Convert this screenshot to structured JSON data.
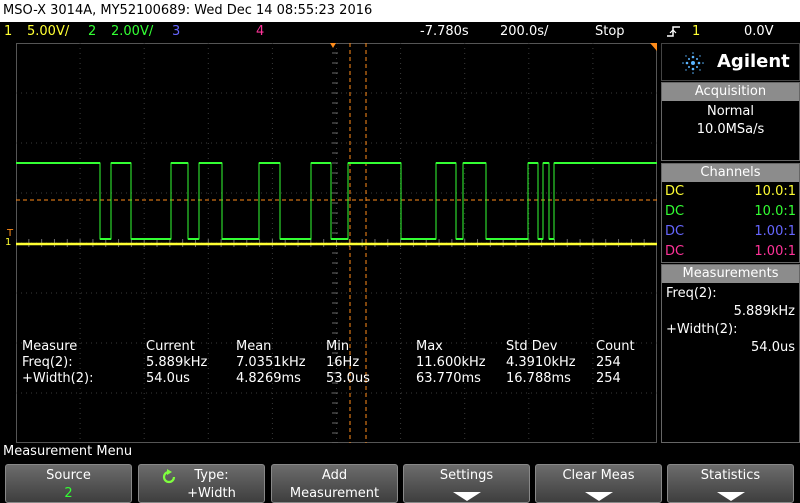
{
  "title": "MSO-X 3014A, MY52100689: Wed Dec 14 08:55:23 2016",
  "status": {
    "ch1_num": "1",
    "ch1_scale": "5.00V/",
    "ch2_num": "2",
    "ch2_scale": "2.00V/",
    "ch3_num": "3",
    "ch4_num": "4",
    "time_offset": "-7.780s",
    "time_scale": "200.0s/",
    "run_state": "Stop",
    "trig_icon": "rising-edge-trigger-icon",
    "trig_ch": "1",
    "trig_level": "0.0V"
  },
  "colors": {
    "ch1": "#ffff33",
    "ch2": "#33ff33",
    "ch3": "#6666ff",
    "ch4": "#ff3399",
    "accent": "#ff8c1a"
  },
  "markers": {
    "ch1_ground": "1",
    "trigger": "T"
  },
  "measurements_table": {
    "headers": [
      "Measure",
      "Current",
      "Mean",
      "Min",
      "Max",
      "Std Dev",
      "Count"
    ],
    "rows": [
      [
        "Freq(2):",
        "5.889kHz",
        "7.0351kHz",
        "16Hz",
        "11.600kHz",
        "4.3910kHz",
        "254"
      ],
      [
        "+Width(2):",
        "54.0us",
        "4.8269ms",
        "53.0us",
        "63.770ms",
        "16.788ms",
        "254"
      ]
    ]
  },
  "panel": {
    "brand": "Agilent",
    "logo_icon": "agilent-spark-icon",
    "acquisition_title": "Acquisition",
    "acq_mode": "Normal",
    "acq_rate": "10.0MSa/s",
    "channels_title": "Channels",
    "channels": [
      {
        "coupling": "DC",
        "ratio": "10.0:1",
        "color": "#ffff33"
      },
      {
        "coupling": "DC",
        "ratio": "10.0:1",
        "color": "#33ff33"
      },
      {
        "coupling": "DC",
        "ratio": "1.00:1",
        "color": "#6666ff"
      },
      {
        "coupling": "DC",
        "ratio": "1.00:1",
        "color": "#ff3399"
      }
    ],
    "measurements_title": "Measurements",
    "meas1_label": "Freq(2):",
    "meas1_value": "5.889kHz",
    "meas2_label": "+Width(2):",
    "meas2_value": "54.0us"
  },
  "menu": {
    "title": "Measurement Menu",
    "softkeys": [
      {
        "l1": "Source",
        "l2": "2"
      },
      {
        "l1": "Type:",
        "l2": "+Width",
        "icon": "rotate-knob-icon"
      },
      {
        "l1": "Add",
        "l2": "Measurement"
      },
      {
        "l1": "Settings",
        "icon": "down-arrow-icon"
      },
      {
        "l1": "Clear Meas",
        "icon": "down-arrow-icon"
      },
      {
        "l1": "Statistics",
        "icon": "down-arrow-icon"
      }
    ]
  }
}
